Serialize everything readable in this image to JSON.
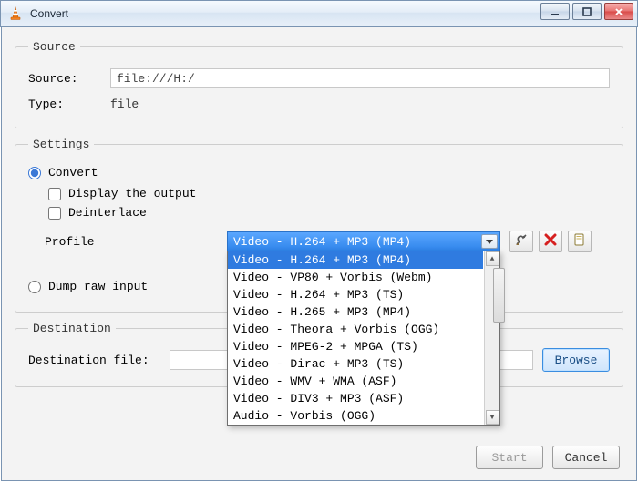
{
  "window": {
    "title": "Convert"
  },
  "source": {
    "legend": "Source",
    "source_label": "Source:",
    "source_value": "file:///H:/",
    "type_label": "Type:",
    "type_value": "file"
  },
  "settings": {
    "legend": "Settings",
    "convert_label": "Convert",
    "display_output_label": "Display the output",
    "deinterlace_label": "Deinterlace",
    "profile_label": "Profile",
    "profile_selected": "Video - H.264 + MP3 (MP4)",
    "profile_options": [
      "Video - H.264 + MP3 (MP4)",
      "Video - VP80 + Vorbis (Webm)",
      "Video - H.264 + MP3 (TS)",
      "Video - H.265 + MP3 (MP4)",
      "Video - Theora + Vorbis (OGG)",
      "Video - MPEG-2 + MPGA (TS)",
      "Video - Dirac + MP3 (TS)",
      "Video - WMV + WMA (ASF)",
      "Video - DIV3 + MP3 (ASF)",
      "Audio - Vorbis (OGG)"
    ],
    "dump_label": "Dump raw input"
  },
  "destination": {
    "legend": "Destination",
    "file_label": "Destination file:",
    "file_value": "",
    "browse_label": "Browse"
  },
  "footer": {
    "start_label": "Start",
    "cancel_label": "Cancel"
  },
  "icons": {
    "tools": "tools-icon",
    "delete": "delete-icon",
    "new": "new-profile-icon"
  }
}
